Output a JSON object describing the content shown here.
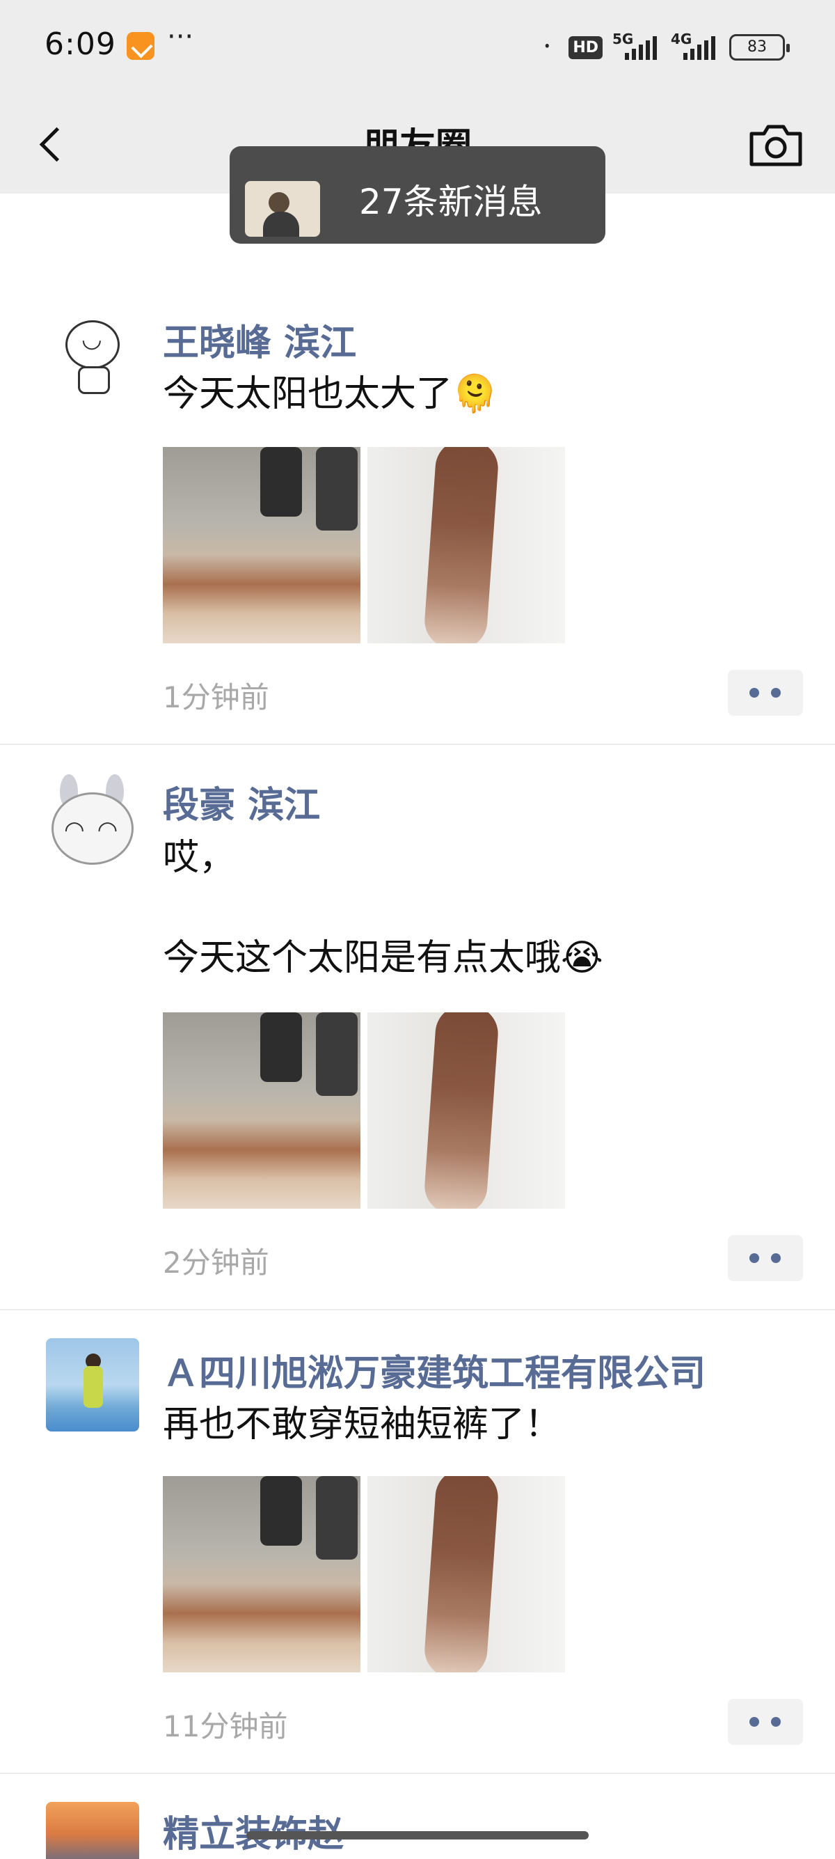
{
  "status_bar": {
    "time": "6:09",
    "dots": "···",
    "hd": "HD",
    "sig1": "5G",
    "sig2": "4G",
    "battery": "83"
  },
  "nav": {
    "title": "朋友圈"
  },
  "new_messages": {
    "text": "27条新消息"
  },
  "posts": [
    {
      "name": "王晓峰 滨江",
      "content": "今天太阳也太大了🫠",
      "time": "1分钟前"
    },
    {
      "name": "段豪 滨江",
      "content": "哎，\n\n今天这个太阳是有点太哦😭",
      "time": "2分钟前"
    },
    {
      "name": "Ａ四川旭淞万豪建筑工程有限公司",
      "content": "再也不敢穿短袖短裤了！",
      "time": "11分钟前"
    },
    {
      "name": "精立装饰赵"
    }
  ],
  "colors": {
    "name": "#576b95",
    "header_bg": "#ededed",
    "time": "#a8a8a8"
  }
}
